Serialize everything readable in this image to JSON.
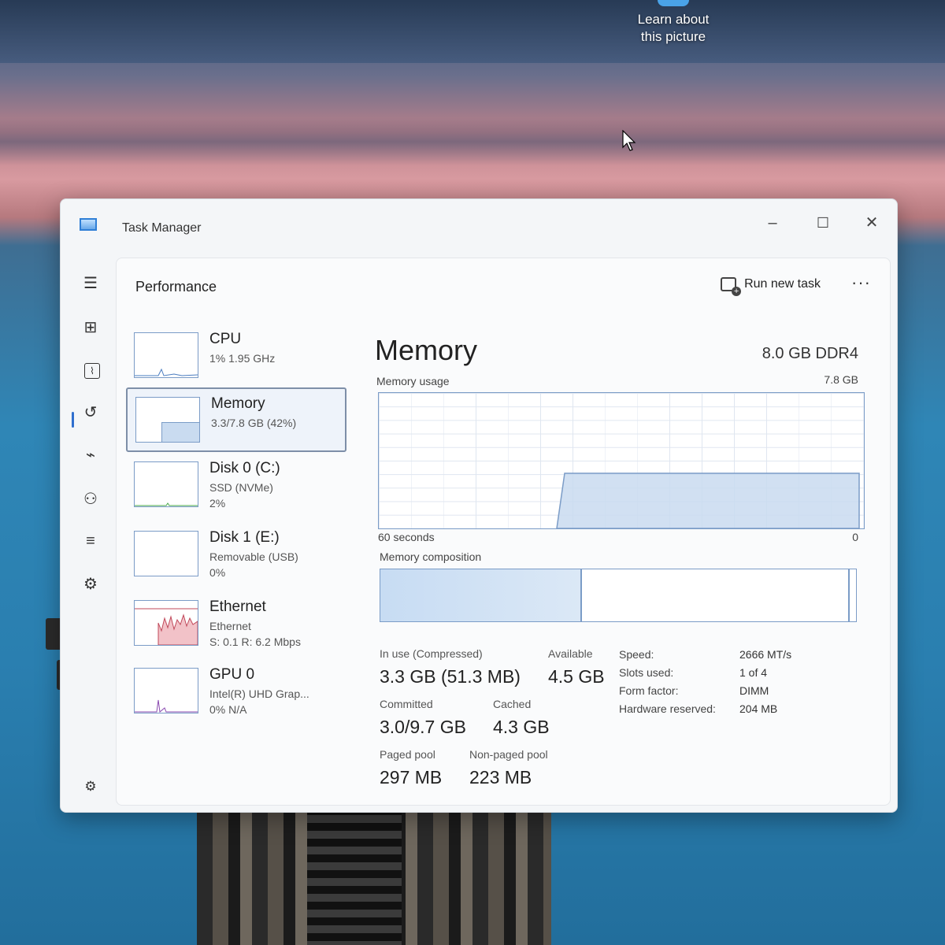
{
  "desktop": {
    "learn_label_1": "Learn about",
    "learn_label_2": "this picture"
  },
  "window": {
    "title": "Task Manager",
    "minimize": "–",
    "maximize": "☐",
    "close": "✕"
  },
  "sidebar": {
    "items": [
      {
        "name": "menu-icon",
        "glyph": "☰"
      },
      {
        "name": "processes-icon",
        "glyph": "⊞"
      },
      {
        "name": "performance-icon",
        "glyph": "⌇"
      },
      {
        "name": "app-history-icon",
        "glyph": "↺"
      },
      {
        "name": "startup-apps-icon",
        "glyph": "⌁"
      },
      {
        "name": "users-icon",
        "glyph": "⚇"
      },
      {
        "name": "details-icon",
        "glyph": "≡"
      },
      {
        "name": "services-icon",
        "glyph": "⚙"
      },
      {
        "name": "settings-icon",
        "glyph": "⚙"
      }
    ]
  },
  "header": {
    "title": "Performance",
    "run_new_task": "Run new task",
    "more": "···"
  },
  "devices": [
    {
      "name": "CPU",
      "sub1": "1%  1.95 GHz",
      "sub2": ""
    },
    {
      "name": "Memory",
      "sub1": "3.3/7.8 GB (42%)",
      "sub2": ""
    },
    {
      "name": "Disk 0 (C:)",
      "sub1": "SSD (NVMe)",
      "sub2": "2%"
    },
    {
      "name": "Disk 1 (E:)",
      "sub1": "Removable (USB)",
      "sub2": "0%"
    },
    {
      "name": "Ethernet",
      "sub1": "Ethernet",
      "sub2": "S: 0.1  R: 6.2 Mbps"
    },
    {
      "name": "GPU 0",
      "sub1": "Intel(R) UHD Grap...",
      "sub2": "0%  N/A"
    }
  ],
  "memory": {
    "title": "Memory",
    "type": "8.0 GB DDR4",
    "usage_label": "Memory usage",
    "usage_max": "7.8 GB",
    "time_left": "60 seconds",
    "time_right": "0",
    "composition_label": "Memory composition",
    "in_use_fraction": 0.42,
    "stats": {
      "in_use_label": "In use (Compressed)",
      "in_use_value": "3.3 GB (51.3 MB)",
      "available_label": "Available",
      "available_value": "4.5 GB",
      "committed_label": "Committed",
      "committed_value": "3.0/9.7 GB",
      "cached_label": "Cached",
      "cached_value": "4.3 GB",
      "paged_label": "Paged pool",
      "paged_value": "297 MB",
      "nonpaged_label": "Non-paged pool",
      "nonpaged_value": "223 MB"
    },
    "specs": {
      "speed_label": "Speed:",
      "speed_value": "2666 MT/s",
      "slots_label": "Slots used:",
      "slots_value": "1 of 4",
      "form_label": "Form factor:",
      "form_value": "DIMM",
      "hw_label": "Hardware reserved:",
      "hw_value": "204 MB"
    }
  }
}
